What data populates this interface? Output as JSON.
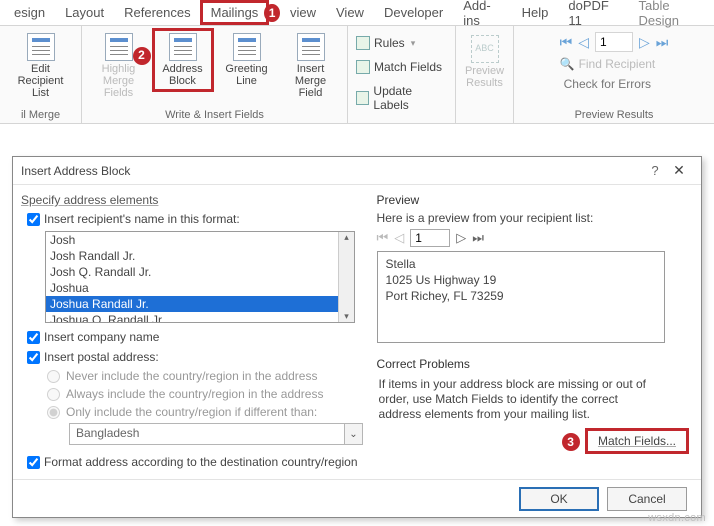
{
  "tabs": {
    "t0": "esign",
    "t1": "Layout",
    "t2": "References",
    "t3": "Mailings",
    "t4": "view",
    "t5": "View",
    "t6": "Developer",
    "t7": "Add-ins",
    "t8": "Help",
    "t9": "doPDF 11",
    "t10": "Table Design"
  },
  "markers": {
    "m1": "1",
    "m2": "2",
    "m3": "3"
  },
  "ribbon": {
    "edit_recip": "Edit\nRecipient List",
    "highlight": "Highlig\nMerge Fields",
    "address_block": "Address\nBlock",
    "greeting": "Greeting\nLine",
    "insert_merge": "Insert Merge\nField",
    "rules": "Rules",
    "match_fields": "Match Fields",
    "update_labels": "Update Labels",
    "preview_results": "Preview\nResults",
    "nav_value": "1",
    "find_recipient": "Find Recipient",
    "check_errors": "Check for Errors",
    "grp_mailmerge": "il Merge",
    "grp_write": "Write & Insert Fields",
    "grp_preview": "Preview Results"
  },
  "dialog": {
    "title": "Insert Address Block",
    "spec_header": "Specify address elements",
    "insert_name": "Insert recipient's name in this format:",
    "names": [
      "Josh",
      "Josh Randall Jr.",
      "Josh Q. Randall Jr.",
      "Joshua",
      "Joshua Randall Jr.",
      "Joshua Q. Randall Jr."
    ],
    "insert_company": "Insert company name",
    "insert_postal": "Insert postal address:",
    "r1": "Never include the country/region in the address",
    "r2": "Always include the country/region in the address",
    "r3": "Only include the country/region if different than:",
    "country": "Bangladesh",
    "format_dest": "Format address according to the destination country/region",
    "preview_header": "Preview",
    "preview_hint": "Here is a preview from your recipient list:",
    "preview_idx": "1",
    "preview_lines": {
      "l1": "Stella",
      "l2": "1025 Us Highway 19",
      "l3": "Port Richey, FL 73259"
    },
    "corr_header": "Correct Problems",
    "corr_text": "If items in your address block are missing or out of order, use Match Fields to identify the correct address elements from your mailing list.",
    "match_btn": "Match Fields...",
    "ok": "OK",
    "cancel": "Cancel"
  },
  "watermark": "wsxdn.com"
}
